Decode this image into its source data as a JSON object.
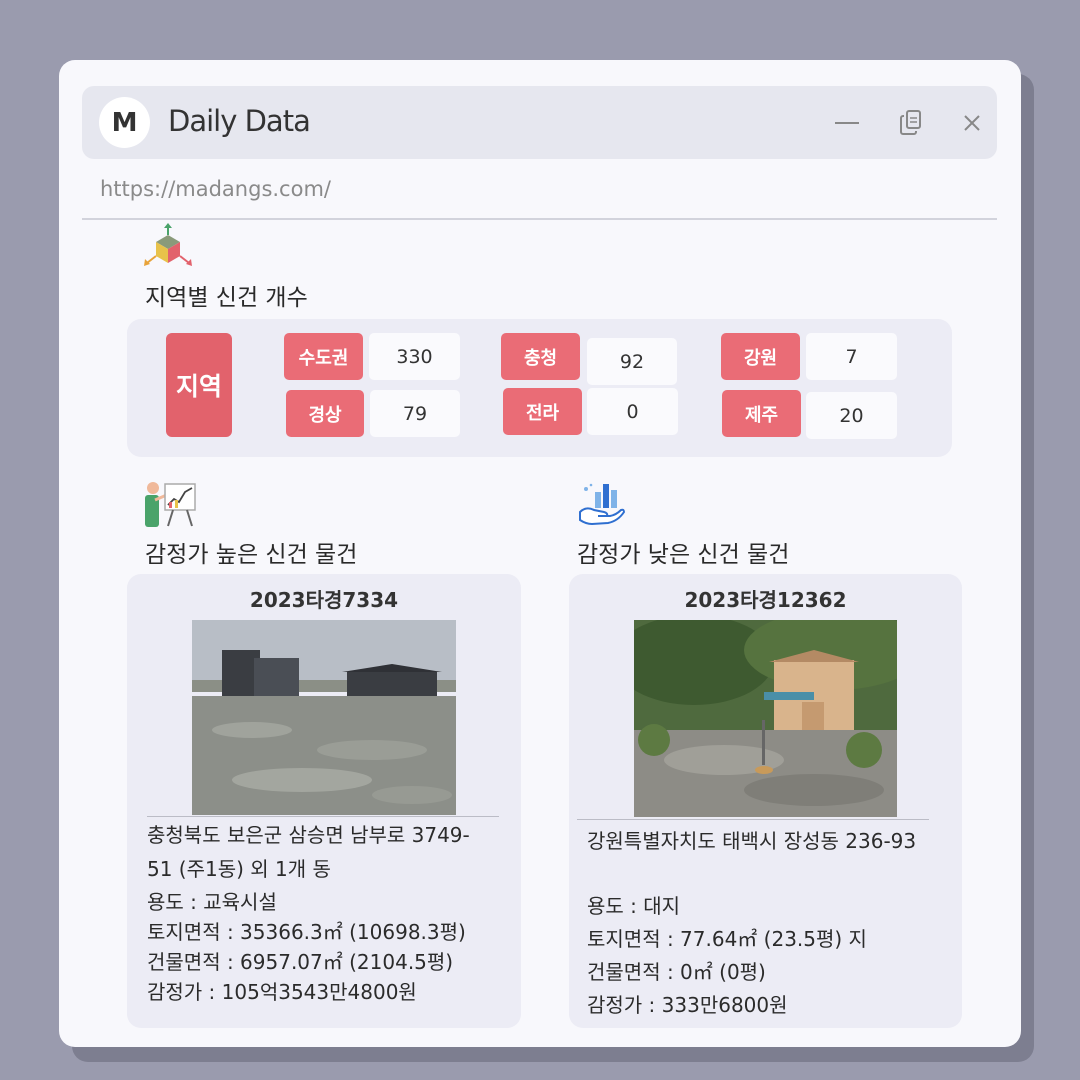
{
  "window": {
    "logo_letter": "M",
    "app_title": "Daily Data",
    "url": "https://madangs.com/"
  },
  "icons": {
    "region_section": "3d-axis-cube-icon",
    "high_section": "presentation-chart-icon",
    "low_section": "hand-bar-chart-icon",
    "minimize": "minimize-icon",
    "copy": "copy-icon",
    "close": "close-icon"
  },
  "region_section": {
    "title": "지역별 신건 개수",
    "main_label": "지역",
    "regions": [
      {
        "name": "수도권",
        "count": "330"
      },
      {
        "name": "경상",
        "count": "79"
      },
      {
        "name": "충청",
        "count": "92"
      },
      {
        "name": "전라",
        "count": "0"
      },
      {
        "name": "강원",
        "count": "7"
      },
      {
        "name": "제주",
        "count": "20"
      }
    ]
  },
  "high_section": {
    "title": "감정가 높은 신건 물건",
    "case_no": "2023타경7334",
    "address_line1": "충청북도 보은군 삼승면 남부로 3749-",
    "address_line2": "51 (주1동) 외 1개 동",
    "usage": "용도 : 교육시설",
    "land_area": "토지면적 : 35366.3㎡ (10698.3평)",
    "building_area": "건물면적 : 6957.07㎡ (2104.5평)",
    "appraisal": "감정가 : 105억3543만4800원"
  },
  "low_section": {
    "title": "감정가 낮은 신건 물건",
    "case_no": "2023타경12362",
    "address_line1": "강원특별자치도 태백시 장성동 236-93",
    "usage": "용도 :  대지",
    "land_area": "토지면적 : 77.64㎡ (23.5평) 지",
    "building_area": "건물면적 : 0㎡ (0평)",
    "appraisal": "감정가 : 333만6800원"
  },
  "colors": {
    "page_bg": "#9a9bae",
    "window_bg": "#f8f8fc",
    "titlebar_bg": "#e6e7ef",
    "panel_bg": "#ececf5",
    "tag_red": "#ea6c76",
    "main_red": "#e2626c"
  }
}
